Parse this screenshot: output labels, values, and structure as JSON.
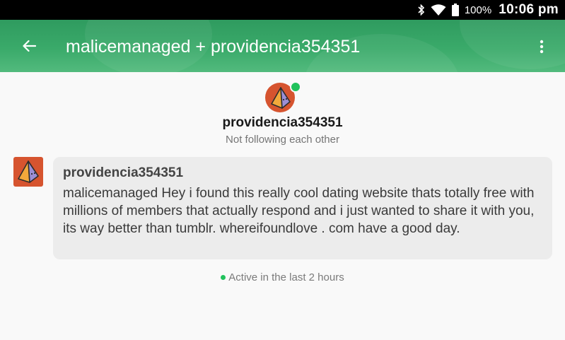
{
  "status_bar": {
    "battery_percent": "100%",
    "time": "10:06 pm",
    "icons": [
      "bluetooth-icon",
      "wifi-icon",
      "battery-icon"
    ]
  },
  "toolbar": {
    "title": "malicemanaged + providencia354351",
    "back_icon": "arrow-left-icon",
    "menu_icon": "more-vertical-icon",
    "color": "#35a265"
  },
  "profile": {
    "name": "providencia354351",
    "relationship": "Not following each other",
    "online": true
  },
  "messages": [
    {
      "sender": "providencia354351",
      "text": "malicemanaged Hey i found this really cool dating website thats totally free with millions of members that actually respond and i just wanted to share it with you, its way better than tumblr. whereifoundlove . com have a good day."
    }
  ],
  "activity": {
    "text": "Active in the last 2 hours",
    "status_color": "#21c25c"
  }
}
